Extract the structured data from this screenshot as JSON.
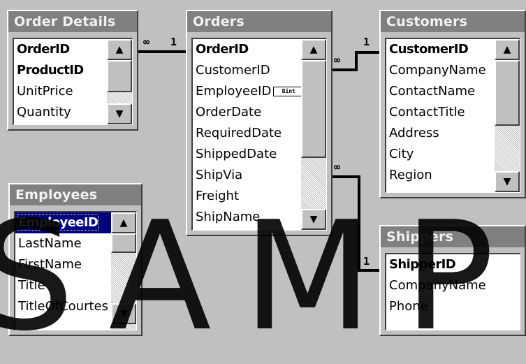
{
  "tables": {
    "order_details": {
      "title": "Order Details",
      "fields": [
        "OrderID",
        "ProductID",
        "UnitPrice",
        "Quantity"
      ]
    },
    "orders": {
      "title": "Orders",
      "fields": [
        "OrderID",
        "CustomerID",
        "EmployeeID",
        "OrderDate",
        "RequiredDate",
        "ShippedDate",
        "ShipVia",
        "Freight",
        "ShipName"
      ],
      "badge": "Bint"
    },
    "customers": {
      "title": "Customers",
      "fields": [
        "CustomerID",
        "CompanyName",
        "ContactName",
        "ContactTitle",
        "Address",
        "City",
        "Region"
      ]
    },
    "employees": {
      "title": "Employees",
      "fields": [
        "EmployeeID",
        "LastName",
        "FirstName",
        "Title",
        "TitleOfCourtes"
      ]
    },
    "shippers": {
      "title": "Shippers",
      "fields": [
        "ShipperID",
        "CompanyName",
        "Phone"
      ]
    }
  },
  "relationships": {
    "od_orders": {
      "many": "∞",
      "one": "1"
    },
    "orders_customers": {
      "many": "∞",
      "one": "1"
    },
    "orders_shippers": {
      "many": "∞",
      "one": "1"
    }
  },
  "scroll_arrows": {
    "up": "▲",
    "down": "▼"
  },
  "watermark": "SAMP"
}
